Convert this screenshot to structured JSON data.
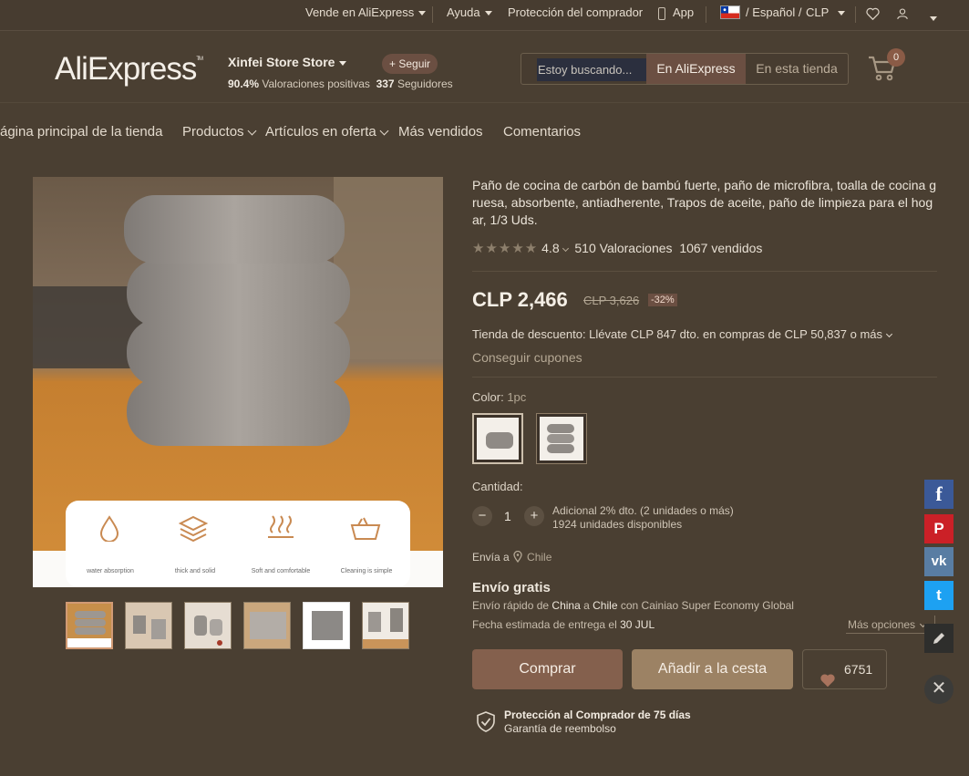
{
  "topbar": {
    "sell": "Vende en AliExpress",
    "help": "Ayuda",
    "protection": "Protección del comprador",
    "app": "App",
    "language": "/ Español /",
    "currency": "CLP"
  },
  "header": {
    "logo": "AliExpress",
    "store_name": "Xinfei Store Store",
    "follow": "+ Seguir",
    "positive_pct": "90.4%",
    "positive_label": "Valoraciones positivas",
    "followers_count": "337",
    "followers_label": "Seguidores",
    "search_placeholder": "Estoy buscando...",
    "search_ali": "En AliExpress",
    "search_store": "En esta tienda",
    "cart_count": "0"
  },
  "nav": {
    "home": "ágina principal de la tienda",
    "products": "Productos",
    "deals": "Artículos en oferta",
    "bestsellers": "Más vendidos",
    "reviews": "Comentarios"
  },
  "image_features": [
    "water absorption",
    "thick and solid",
    "Soft and comfortable",
    "Cleaning is simple"
  ],
  "product": {
    "title": "Paño de cocina de carbón de bambú fuerte, paño de microfibra, toalla de cocina gruesa, absorbente, antiadherente, Trapos de aceite, paño de limpieza para el hogar, 1/3 Uds.",
    "stars": "★★★★★",
    "rating": "4.8",
    "reviews": "510 Valoraciones",
    "sold": "1067 vendidos",
    "price": "CLP 2,466",
    "old_price": "CLP 3,626",
    "discount": "-32%",
    "store_discount": "Tienda de descuento: Llévate CLP 847 dto. en compras de CLP 50,837 o más",
    "coupons": "Conseguir cupones",
    "color_label": "Color:",
    "color_value": "1pc",
    "quantity_label": "Cantidad:",
    "quantity": "1",
    "extra_discount": "Adicional 2% dto. (2 unidades o más)",
    "available": "1924 unidades disponibles",
    "ships_to_label": "Envía a",
    "ships_to": "Chile",
    "free_shipping": "Envío gratis",
    "ship_p1": "Envío rápido de",
    "ship_from": "China",
    "ship_p2": "a",
    "ship_to": "Chile",
    "ship_p3": "con Cainiao Super Economy Global",
    "delivery_label": "Fecha estimada de entrega el",
    "delivery_date": "30 JUL",
    "more_options": "Más opciones",
    "buy": "Comprar",
    "add_cart": "Añadir a la cesta",
    "wishlist_count": "6751",
    "protection_title": "Protección al Comprador de 75 días",
    "protection_sub": "Garantía de reembolso"
  },
  "social": {
    "facebook": "f",
    "pinterest": "P",
    "vk": "vk",
    "twitter": "t",
    "close": "✕"
  },
  "colors": {
    "background": "#4a3f32",
    "accent": "#84604d",
    "cart_button": "#9c8264",
    "facebook": "#3b5998",
    "pinterest": "#cb2027",
    "vk": "#597da3",
    "twitter": "#1da1f2"
  }
}
